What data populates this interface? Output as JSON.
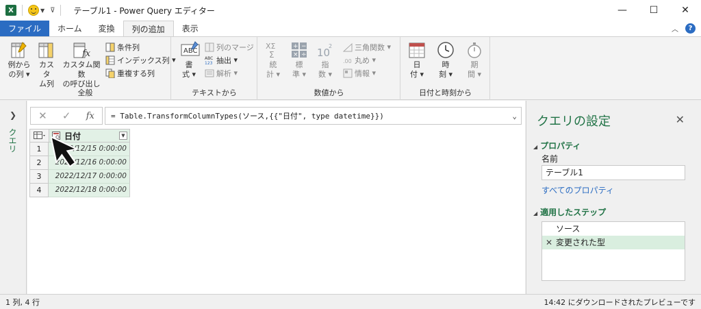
{
  "titlebar": {
    "app_icon_text": "X",
    "title": "テーブル1 - Power Query エディター",
    "minimize": "—",
    "maximize": "☐",
    "close": "✕"
  },
  "tabs": {
    "file": "ファイル",
    "home": "ホーム",
    "transform": "変換",
    "add_column": "列の追加",
    "view": "表示",
    "help": "?"
  },
  "ribbon": {
    "general": {
      "label": "全般",
      "column_from_examples": [
        "例から",
        "の列"
      ],
      "custom_column": [
        "カスタ",
        "ム列"
      ],
      "invoke_custom_function": [
        "カスタム関数",
        "の呼び出し"
      ],
      "conditional_column": "条件列",
      "index_column": "インデックス列",
      "duplicate_column": "重複する列"
    },
    "text": {
      "label": "テキストから",
      "format": [
        "書",
        "式"
      ],
      "merge_columns": "列のマージ",
      "extract": "抽出",
      "parse": "解析"
    },
    "number": {
      "label": "数値から",
      "statistics": [
        "統",
        "計"
      ],
      "standard": [
        "標",
        "準"
      ],
      "scientific": [
        "指",
        "数"
      ],
      "trigonometry": "三角関数",
      "rounding": "丸め",
      "information": "情報"
    },
    "datetime": {
      "label": "日付と時刻から",
      "date": [
        "日",
        "付"
      ],
      "time": [
        "時",
        "刻"
      ],
      "duration": [
        "期",
        "間"
      ]
    }
  },
  "left_pane": {
    "label": "クエリ"
  },
  "formula_bar": {
    "cancel": "✕",
    "commit": "✓",
    "fx": "fx",
    "formula": "= Table.TransformColumnTypes(ソース,{{\"日付\", type datetime}})"
  },
  "grid": {
    "column_header": "日付",
    "rows": [
      {
        "num": "1",
        "value": "2022/12/15 0:00:00"
      },
      {
        "num": "2",
        "value": "2022/12/16 0:00:00"
      },
      {
        "num": "3",
        "value": "2022/12/17 0:00:00"
      },
      {
        "num": "4",
        "value": "2022/12/18 0:00:00"
      }
    ]
  },
  "query_settings": {
    "title": "クエリの設定",
    "properties_header": "プロパティ",
    "name_label": "名前",
    "name_value": "テーブル1",
    "all_properties": "すべてのプロパティ",
    "applied_steps_header": "適用したステップ",
    "steps": [
      "ソース",
      "変更された型"
    ]
  },
  "status": {
    "left": "1 列, 4 行",
    "right": "14:42 にダウンロードされたプレビューです"
  },
  "colors": {
    "accent_green": "#217346",
    "file_tab_blue": "#2b6cc2",
    "column_selected": "#e2f1e6"
  }
}
